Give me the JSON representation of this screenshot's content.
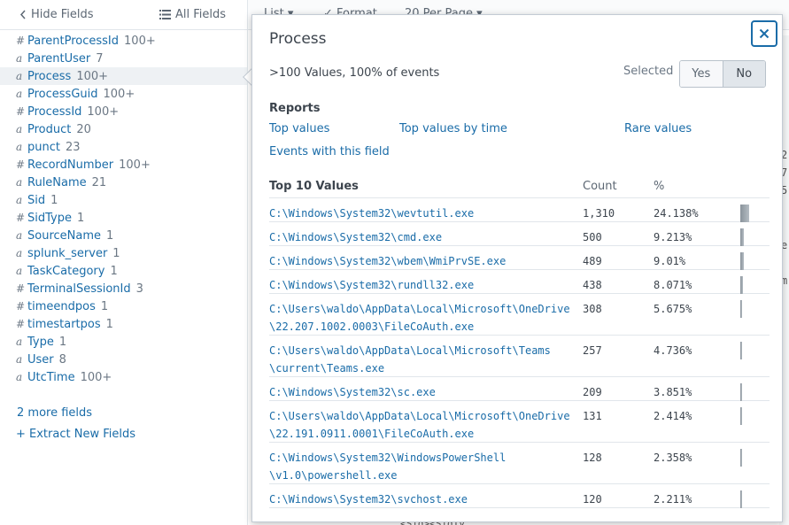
{
  "sidebar": {
    "hide_fields": "Hide Fields",
    "all_fields": "All Fields",
    "fields": [
      {
        "type": "#",
        "name": "ParentProcessId",
        "count": "100+"
      },
      {
        "type": "a",
        "name": "ParentUser",
        "count": "7"
      },
      {
        "type": "a",
        "name": "Process",
        "count": "100+",
        "selected": true
      },
      {
        "type": "a",
        "name": "ProcessGuid",
        "count": "100+"
      },
      {
        "type": "#",
        "name": "ProcessId",
        "count": "100+"
      },
      {
        "type": "a",
        "name": "Product",
        "count": "20"
      },
      {
        "type": "a",
        "name": "punct",
        "count": "23"
      },
      {
        "type": "#",
        "name": "RecordNumber",
        "count": "100+"
      },
      {
        "type": "a",
        "name": "RuleName",
        "count": "21"
      },
      {
        "type": "a",
        "name": "Sid",
        "count": "1"
      },
      {
        "type": "#",
        "name": "SidType",
        "count": "1"
      },
      {
        "type": "a",
        "name": "SourceName",
        "count": "1"
      },
      {
        "type": "a",
        "name": "splunk_server",
        "count": "1"
      },
      {
        "type": "a",
        "name": "TaskCategory",
        "count": "1"
      },
      {
        "type": "#",
        "name": "TerminalSessionId",
        "count": "3"
      },
      {
        "type": "#",
        "name": "timeendpos",
        "count": "1"
      },
      {
        "type": "#",
        "name": "timestartpos",
        "count": "1"
      },
      {
        "type": "a",
        "name": "Type",
        "count": "1"
      },
      {
        "type": "a",
        "name": "User",
        "count": "8"
      },
      {
        "type": "a",
        "name": "UtcTime",
        "count": "100+"
      }
    ],
    "more_fields": "2 more fields",
    "extract_new_fields": "+ Extract New Fields"
  },
  "toolbar": {
    "list": "List ▾",
    "format": "✓ Format",
    "per_page": "20 Per Page ▾"
  },
  "background_fragments": {
    "right": [
      "2",
      "7",
      "5",
      "e",
      "m"
    ],
    "bottom": "<Sid><SidTy"
  },
  "popover": {
    "title": "Process",
    "summary": ">100 Values, 100% of events",
    "selected_label": "Selected",
    "yes": "Yes",
    "no": "No",
    "reports_heading": "Reports",
    "reports": {
      "top_values": "Top values",
      "top_values_by_time": "Top values by time",
      "rare_values": "Rare values",
      "events_with_field": "Events with this field"
    },
    "table": {
      "col_values": "Top 10 Values",
      "col_count": "Count",
      "col_pct": "%"
    },
    "rows": [
      {
        "value": "C:\\Windows\\System32\\wevtutil.exe",
        "count": "1,310",
        "pct": "24.138%",
        "share": 24.138
      },
      {
        "value": "C:\\Windows\\System32\\cmd.exe",
        "count": "500",
        "pct": "9.213%",
        "share": 9.213
      },
      {
        "value": "C:\\Windows\\System32\\wbem\\WmiPrvSE.exe",
        "count": "489",
        "pct": "9.01%",
        "share": 9.01
      },
      {
        "value": "C:\\Windows\\System32\\rundll32.exe",
        "count": "438",
        "pct": "8.071%",
        "share": 8.071
      },
      {
        "value": "C:\\Users\\waldo\\AppData\\Local\\Microsoft\\OneDrive\n\\22.207.1002.0003\\FileCoAuth.exe",
        "count": "308",
        "pct": "5.675%",
        "share": 5.675
      },
      {
        "value": "C:\\Users\\waldo\\AppData\\Local\\Microsoft\\Teams\n\\current\\Teams.exe",
        "count": "257",
        "pct": "4.736%",
        "share": 4.736
      },
      {
        "value": "C:\\Windows\\System32\\sc.exe",
        "count": "209",
        "pct": "3.851%",
        "share": 3.851
      },
      {
        "value": "C:\\Users\\waldo\\AppData\\Local\\Microsoft\\OneDrive\n\\22.191.0911.0001\\FileCoAuth.exe",
        "count": "131",
        "pct": "2.414%",
        "share": 2.414
      },
      {
        "value": "C:\\Windows\\System32\\WindowsPowerShell\n\\v1.0\\powershell.exe",
        "count": "128",
        "pct": "2.358%",
        "share": 2.358
      },
      {
        "value": "C:\\Windows\\System32\\svchost.exe",
        "count": "120",
        "pct": "2.211%",
        "share": 2.211
      }
    ]
  },
  "colors": {
    "link": "#1a6ca8",
    "close_border": "#1a6ca8",
    "bar": "#8a939b"
  }
}
